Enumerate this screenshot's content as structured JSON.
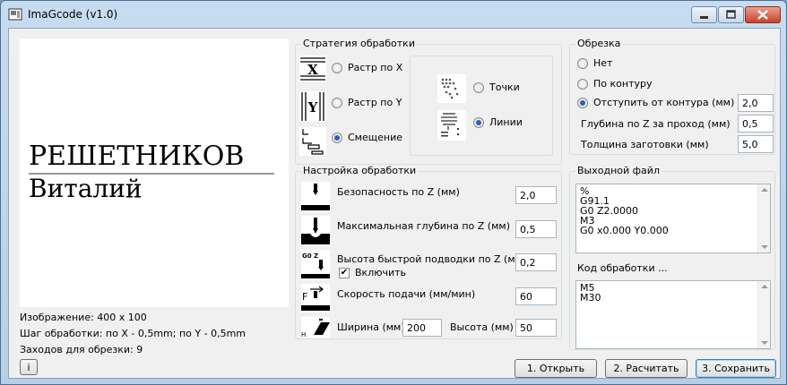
{
  "window": {
    "title": "ImaGcode (v1.0)"
  },
  "preview": {
    "line1": "РЕШЕТНИКОВ",
    "line2": "Виталий"
  },
  "info": {
    "image": "Изображение: 400 x 100",
    "step": "Шаг обработки: по X - 0,5mm; по Y - 0,5mm",
    "passes": "Заходов для обрезки: 9",
    "button": "i"
  },
  "strategy": {
    "title": "Стратегия обработки",
    "raster_x": "Растр по X",
    "raster_y": "Растр по Y",
    "offset": "Смещение",
    "points": "Точки",
    "lines": "Линии",
    "selected_strategy": "Смещение",
    "selected_type": "Линии"
  },
  "trim": {
    "title": "Обрезка",
    "none": "Нет",
    "contour": "По контуру",
    "offset_label": "Отступить от контура (мм)",
    "offset_value": "2,0",
    "depth_label": "Глубина по Z за проход (мм)",
    "depth_value": "0,5",
    "thickness_label": "Толщина заготовки (мм)",
    "thickness_value": "5,0",
    "selected": "Отступить от контура (мм)"
  },
  "setup": {
    "title": "Настройка обработки",
    "safety_label": "Безопасность по Z (мм)",
    "safety_value": "2,0",
    "maxdepth_label": "Максимальная глубина по Z (мм)",
    "maxdepth_value": "0,5",
    "rapid_label": "Высота быстрой подводки по Z (мм)",
    "rapid_value": "0,2",
    "rapid_enable": "Включить",
    "rapid_enabled": true,
    "feed_label": "Скорость подачи (мм/мин)",
    "feed_value": "60",
    "width_label": "Ширина (мм)",
    "width_value": "200",
    "height_label": "Высота (мм)",
    "height_value": "50",
    "g0_icon_text": "G0 Z",
    "feed_icon_text": "F"
  },
  "output": {
    "title": "Выходной файл",
    "lines": [
      "%",
      "G91.1",
      "G0 Z2.0000",
      "M3",
      "G0 x0.000 Y0.000"
    ]
  },
  "code": {
    "title": "Код обработки ...",
    "lines": [
      "M5",
      "M30"
    ]
  },
  "buttons": {
    "open": "1. Открыть",
    "calc": "2. Расчитать",
    "save": "3. Сохранить"
  },
  "colors": {
    "radio_dot": "#2b63b8",
    "close_button": "#c9432a"
  }
}
